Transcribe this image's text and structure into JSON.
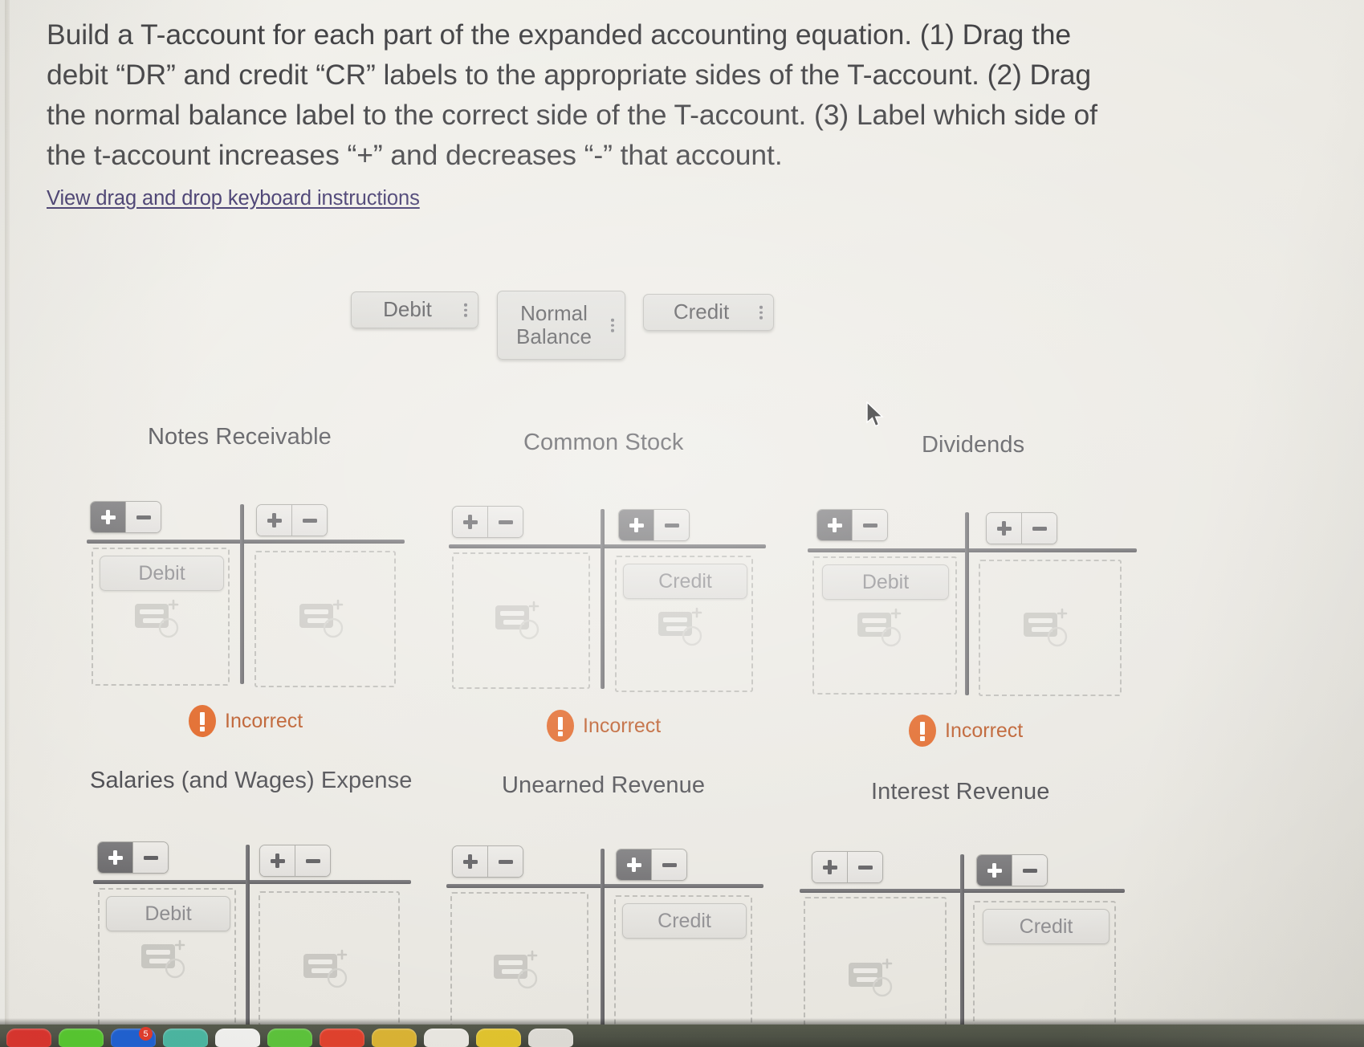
{
  "prompt": {
    "line1": "Build a T-account for each part of the expanded accounting equation.",
    "line2": "(1) Drag the debit “DR” and credit “CR” labels to the appropriate sides of",
    "line3": "the T-account. (2) Drag the normal balance label to the correct side of",
    "line4": "the T-account. (3) Label which side of the t-account increases “+” and",
    "line5": "decreases “-” that account.",
    "keyboard_link": "View drag and drop keyboard instructions"
  },
  "tray": {
    "chips": [
      {
        "label": "Debit",
        "handle": "drag-handle-icon"
      },
      {
        "label": "Normal Balance",
        "handle": "drag-handle-icon"
      },
      {
        "label": "Credit",
        "handle": "drag-handle-icon"
      }
    ]
  },
  "toggle": {
    "plus": "+",
    "minus": "−"
  },
  "status": {
    "incorrect_label": "Incorrect",
    "incorrect_icon": "exclamation-circle-icon",
    "incorrect_color": "#e0601d",
    "incorrect_text_color": "#b8521e"
  },
  "accounts": [
    {
      "title": "Notes Receivable",
      "left_toggle": {
        "plus_selected": true,
        "minus_selected": false
      },
      "right_toggle": {
        "plus_selected": false,
        "minus_selected": false
      },
      "left_drop": {
        "chip": "Debit"
      },
      "right_drop": {
        "chip": ""
      },
      "feedback": "Incorrect"
    },
    {
      "title": "Common Stock",
      "left_toggle": {
        "plus_selected": false,
        "minus_selected": false
      },
      "right_toggle": {
        "plus_selected": true,
        "minus_selected": false
      },
      "left_drop": {
        "chip": ""
      },
      "right_drop": {
        "chip": "Credit"
      },
      "feedback": "Incorrect"
    },
    {
      "title": "Dividends",
      "left_toggle": {
        "plus_selected": true,
        "minus_selected": false
      },
      "right_toggle": {
        "plus_selected": false,
        "minus_selected": false
      },
      "left_drop": {
        "chip": "Debit"
      },
      "right_drop": {
        "chip": ""
      },
      "feedback": "Incorrect"
    },
    {
      "title": "Salaries (and Wages) Expense",
      "left_toggle": {
        "plus_selected": true,
        "minus_selected": false
      },
      "right_toggle": {
        "plus_selected": false,
        "minus_selected": false
      },
      "left_drop": {
        "chip": "Debit"
      },
      "right_drop": {
        "chip": ""
      },
      "feedback": ""
    },
    {
      "title": "Unearned Revenue",
      "left_toggle": {
        "plus_selected": false,
        "minus_selected": false
      },
      "right_toggle": {
        "plus_selected": true,
        "minus_selected": false
      },
      "left_drop": {
        "chip": ""
      },
      "right_drop": {
        "chip": "Credit"
      },
      "feedback": ""
    },
    {
      "title": "Interest Revenue",
      "left_toggle": {
        "plus_selected": false,
        "minus_selected": false
      },
      "right_toggle": {
        "plus_selected": true,
        "minus_selected": false
      },
      "left_drop": {
        "chip": ""
      },
      "right_drop": {
        "chip": "Credit"
      },
      "feedback": ""
    }
  ],
  "dock": {
    "icons": [
      {
        "name": "dock-icon-1",
        "color": "#d9322b"
      },
      {
        "name": "dock-icon-2",
        "color": "#55c62e"
      },
      {
        "name": "dock-icon-3",
        "color": "#1d5fd0",
        "badge": "5"
      },
      {
        "name": "dock-icon-4",
        "color": "#4ab5a0"
      },
      {
        "name": "dock-icon-5",
        "color": "#f0f0ee"
      },
      {
        "name": "dock-icon-6",
        "color": "#5bc23a"
      },
      {
        "name": "dock-icon-7",
        "color": "#e0402c"
      },
      {
        "name": "dock-icon-8",
        "color": "#d9b233"
      },
      {
        "name": "dock-icon-9",
        "color": "#e8e6e0",
        "badge": ""
      },
      {
        "name": "dock-icon-10",
        "color": "#e0c22d"
      },
      {
        "name": "dock-icon-11",
        "color": "#dcdad4"
      }
    ]
  }
}
